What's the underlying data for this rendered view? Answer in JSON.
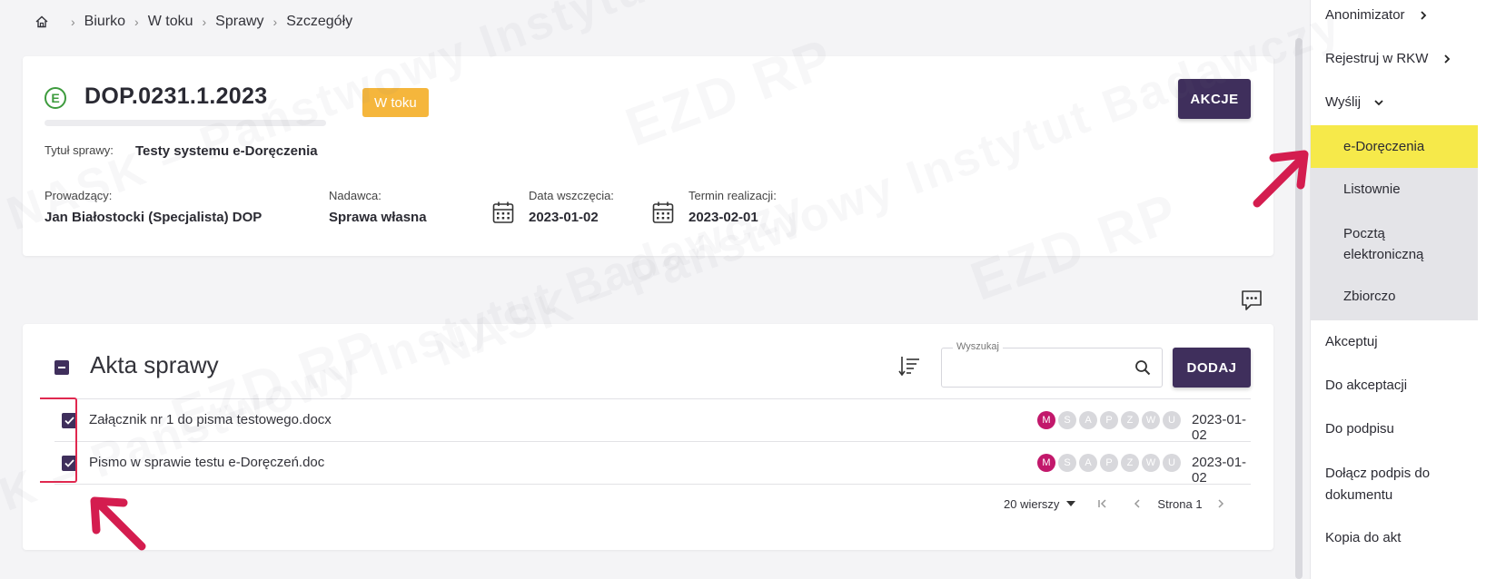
{
  "breadcrumb": {
    "items": [
      "Biurko",
      "W toku",
      "Sprawy",
      "Szczegóły"
    ]
  },
  "case": {
    "number": "DOP.0231.1.2023",
    "status": "W toku",
    "actions_label": "AKCJE",
    "title_label": "Tytuł sprawy:",
    "title_value": "Testy systemu e-Doręczenia",
    "lead_label": "Prowadzący:",
    "lead_value": "Jan Białostocki (Specjalista) DOP",
    "sender_label": "Nadawca:",
    "sender_value": "Sprawa własna",
    "start_label": "Data wszczęcia:",
    "start_value": "2023-01-02",
    "deadline_label": "Termin realizacji:",
    "deadline_value": "2023-02-01"
  },
  "files": {
    "title": "Akta sprawy",
    "search_label": "Wyszukaj",
    "search_value": "",
    "add_label": "DODAJ",
    "rows": [
      {
        "name": "Załącznik nr 1 do pisma testowego.docx",
        "date": "2023-01-02",
        "badges": [
          "M",
          "S",
          "A",
          "P",
          "Z",
          "W",
          "U"
        ],
        "checked": true
      },
      {
        "name": "Pismo w sprawie testu e-Doręczeń.doc",
        "date": "2023-01-02",
        "badges": [
          "M",
          "S",
          "A",
          "P",
          "Z",
          "W",
          "U"
        ],
        "checked": true
      }
    ],
    "pager": {
      "rows_per_page": "20 wierszy",
      "page_label": "Strona 1"
    }
  },
  "sidebar": {
    "items": [
      {
        "label": "Anonimizator",
        "chevron": "right"
      },
      {
        "label": "Rejestruj w RKW",
        "chevron": "right"
      },
      {
        "label": "Wyślij",
        "chevron": "down"
      },
      {
        "label": "e-Doręczenia",
        "sub": true,
        "active": true
      },
      {
        "label": "Listownie",
        "sub": true
      },
      {
        "label": "Pocztą elektroniczną",
        "sub": true
      },
      {
        "label": "Zbiorczo",
        "sub": true
      },
      {
        "label": "Akceptuj"
      },
      {
        "label": "Do akceptacji"
      },
      {
        "label": "Do podpisu"
      },
      {
        "label": "Dołącz podpis do dokumentu"
      },
      {
        "label": "Kopia do akt"
      }
    ]
  },
  "watermark": "NASK – Państwowy Instytut Badawczy",
  "watermark_logo": "EZD RP",
  "colors": {
    "primary": "#3f2f5c",
    "status": "#f5b63c",
    "highlight": "#f6e94a",
    "badge_active": "#c2186b",
    "annotation": "#e0284f"
  }
}
